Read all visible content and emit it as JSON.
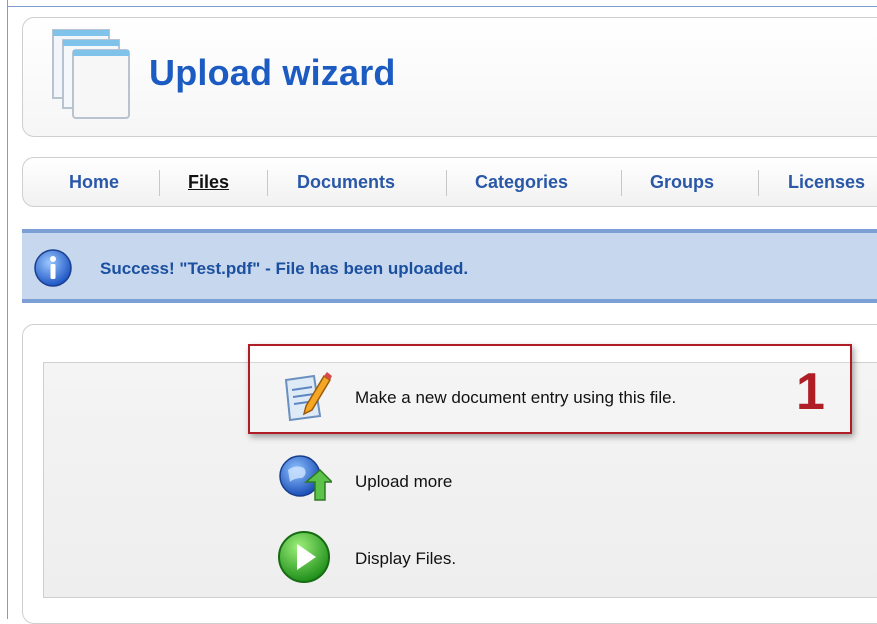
{
  "header": {
    "title": "Upload wizard",
    "icon": "documents-stack-icon"
  },
  "nav": {
    "items": [
      {
        "label": "Home",
        "active": false
      },
      {
        "label": "Files",
        "active": true
      },
      {
        "label": "Documents",
        "active": false
      },
      {
        "label": "Categories",
        "active": false
      },
      {
        "label": "Groups",
        "active": false
      },
      {
        "label": "Licenses",
        "active": false
      }
    ]
  },
  "message": {
    "icon": "info-icon",
    "text": "Success! \"Test.pdf\" - File has been uploaded."
  },
  "actions": [
    {
      "label": "Make a new document entry using this file.",
      "icon": "document-edit-icon"
    },
    {
      "label": "Upload more",
      "icon": "globe-upload-icon"
    },
    {
      "label": "Display Files.",
      "icon": "play-icon"
    }
  ],
  "annotation": {
    "number": "1",
    "color": "#b01e25"
  },
  "colors": {
    "title": "#1c5bc2",
    "nav_link": "#2a58a8",
    "message_bg": "#c7d8ee",
    "message_border": "#7c9fd6"
  }
}
